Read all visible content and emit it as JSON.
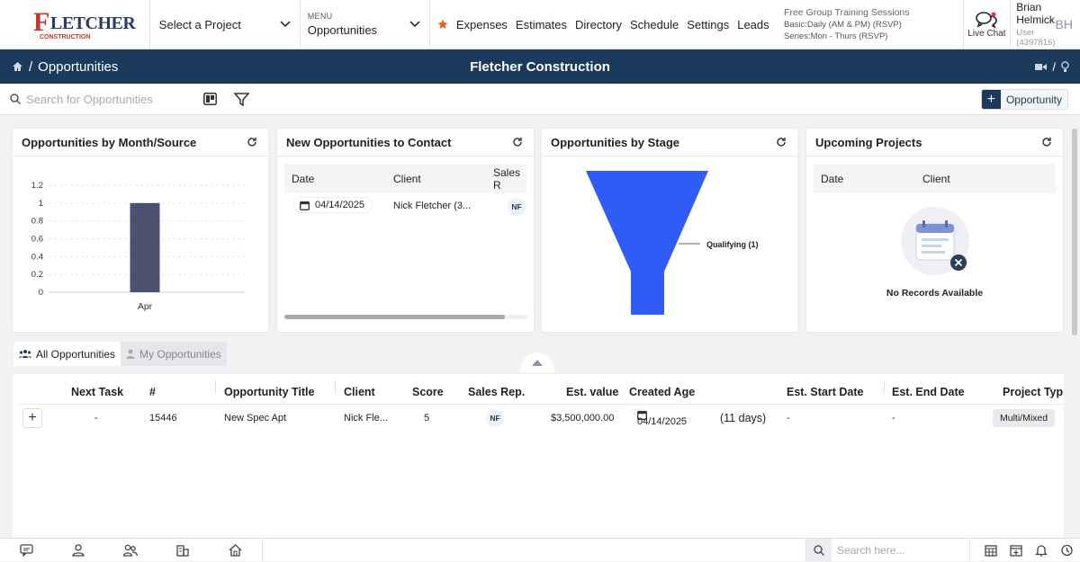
{
  "header": {
    "logo": {
      "big": "F",
      "word": "LETCHER",
      "sub": "CONSTRUCTION"
    },
    "project_select": "Select a Project",
    "menu_caption": "MENU",
    "menu_value": "Opportunities",
    "nav": [
      "Expenses",
      "Estimates",
      "Directory",
      "Schedule",
      "Settings",
      "Leads"
    ],
    "training": {
      "line1": "Free Group Training Sessions",
      "line2": "Basic:Daily (AM & PM) (RSVP)",
      "line3": "Series:Mon - Thurs (RSVP)"
    },
    "live_chat": "Live Chat",
    "user_name": "Brian Helmick",
    "user_id": "User (4397816)",
    "user_initials": "BH"
  },
  "titlebar": {
    "breadcrumb_sep": "/",
    "page": "Opportunities",
    "company": "Fletcher Construction",
    "right_sep": "/"
  },
  "toolbar": {
    "search_placeholder": "Search for Opportunities",
    "add_button": "Opportunity"
  },
  "cards": {
    "month_source": {
      "title": "Opportunities by Month/Source"
    },
    "new_contact": {
      "title": "New Opportunities to Contact",
      "columns": [
        "Date",
        "Client",
        "Sales R"
      ],
      "row": {
        "date": "04/14/2025",
        "client": "Nick Fletcher (3...",
        "sales_rep": "NF"
      }
    },
    "stage": {
      "title": "Opportunities by Stage",
      "label": "Qualifying (1)"
    },
    "upcoming": {
      "title": "Upcoming Projects",
      "columns": [
        "Date",
        "Client"
      ],
      "empty": "No Records Available"
    }
  },
  "chart_data": {
    "type": "bar",
    "categories": [
      "Apr"
    ],
    "values": [
      1
    ],
    "title": "",
    "xlabel": "",
    "ylabel": "",
    "ylim": [
      0,
      1.2
    ],
    "yticks": [
      "1.2",
      "1",
      "0.8",
      "0.6",
      "0.4",
      "0.2",
      "0"
    ],
    "grid": true,
    "bar_color": "#4a5270"
  },
  "tabs": {
    "all": "All Opportunities",
    "mine": "My Opportunities"
  },
  "table": {
    "columns": [
      "Next Task",
      "#",
      "Opportunity Title",
      "Client",
      "Score",
      "Sales Rep.",
      "Est. value",
      "Created Age",
      "Est. Start Date",
      "Est. End Date",
      "Project Typ"
    ],
    "row": {
      "next_task": "-",
      "number": "15446",
      "title": "New Spec Apt",
      "client": "Nick Fle...",
      "score": "5",
      "sales_rep": "NF",
      "est_value": "$3,500,000.00",
      "created_date": "04/14/2025",
      "created_age": "(11 days)",
      "start": "-",
      "end": "-",
      "project_type": "Multi/Mixed"
    }
  },
  "bottom": {
    "search_placeholder": "Search here..."
  },
  "colors": {
    "navy": "#1b3a5c",
    "funnel_blue": "#2f5cf5",
    "star_orange": "#e8621a"
  }
}
